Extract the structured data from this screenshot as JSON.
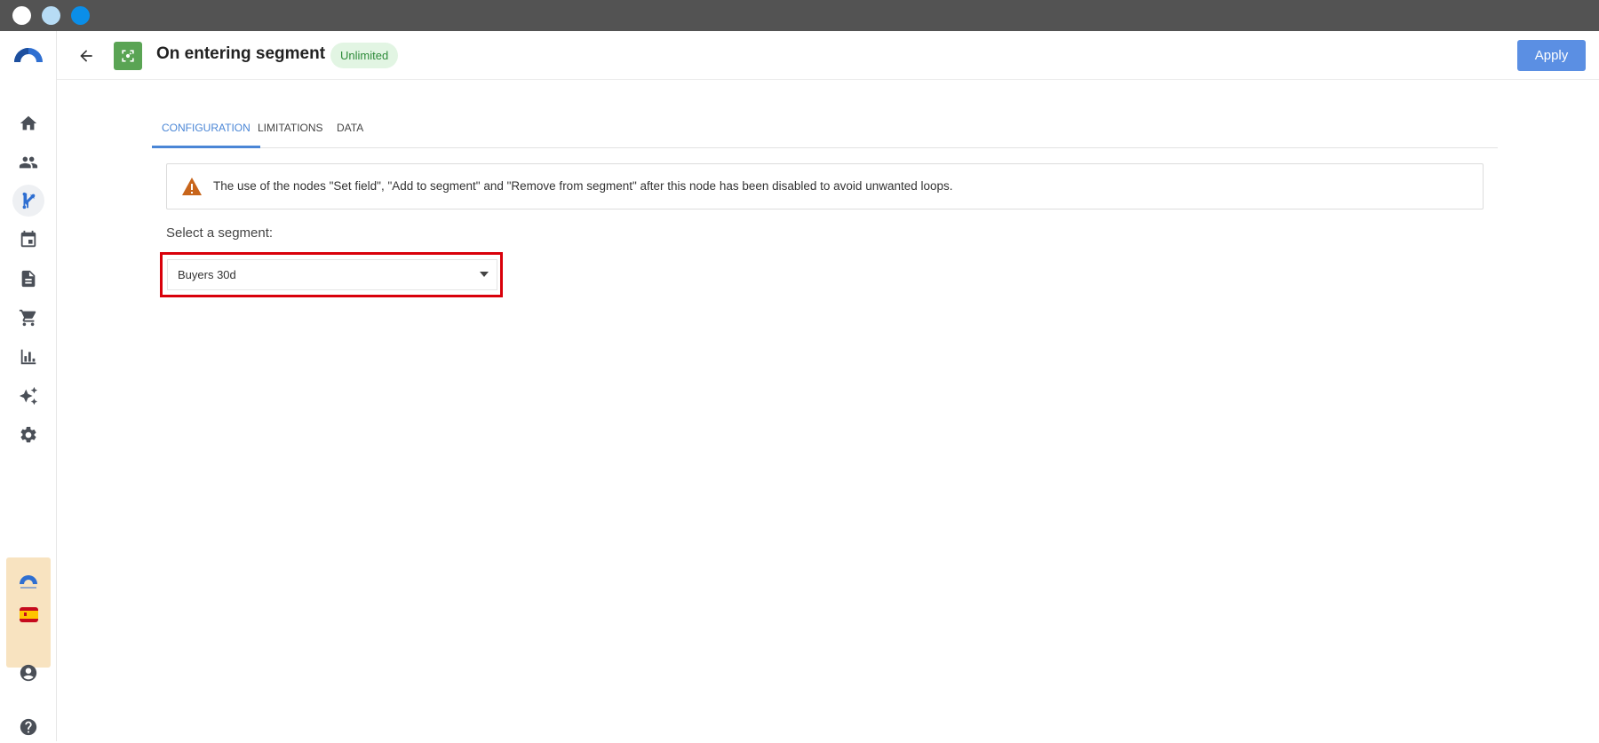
{
  "window": {
    "controls": [
      "close",
      "minimize",
      "maximize"
    ]
  },
  "sidebar": {
    "logo": "app-logo",
    "items": [
      {
        "icon": "home-icon",
        "active": false
      },
      {
        "icon": "people-icon",
        "active": false
      },
      {
        "icon": "workflow-branch-icon",
        "active": true
      },
      {
        "icon": "calendar-icon",
        "active": false
      },
      {
        "icon": "document-icon",
        "active": false
      },
      {
        "icon": "cart-icon",
        "active": false
      },
      {
        "icon": "bar-chart-icon",
        "active": false
      },
      {
        "icon": "sparkles-icon",
        "active": false
      },
      {
        "icon": "gear-icon",
        "active": false
      }
    ],
    "bottom": [
      "brand-logo",
      "spain-flag-icon",
      "account-icon",
      "help-icon"
    ]
  },
  "header": {
    "title": "On entering segment",
    "badge": "Unlimited",
    "apply_label": "Apply"
  },
  "tabs": [
    {
      "label": "CONFIGURATION",
      "active": true
    },
    {
      "label": "LIMITATIONS",
      "active": false
    },
    {
      "label": "DATA",
      "active": false
    }
  ],
  "alert": {
    "icon": "warning-icon",
    "text": "The use of the nodes \"Set field\", \"Add to segment\" and \"Remove from segment\" after this node has been disabled to avoid unwanted loops."
  },
  "form": {
    "segment_label": "Select a segment:",
    "segment_value": "Buyers 30d"
  },
  "colors": {
    "accent": "#5b8fe3",
    "node_green": "#5aa454",
    "badge_bg": "#e2f5e3",
    "badge_text": "#2e8b3a",
    "warning": "#c8651b",
    "highlight": "#d9000a"
  }
}
